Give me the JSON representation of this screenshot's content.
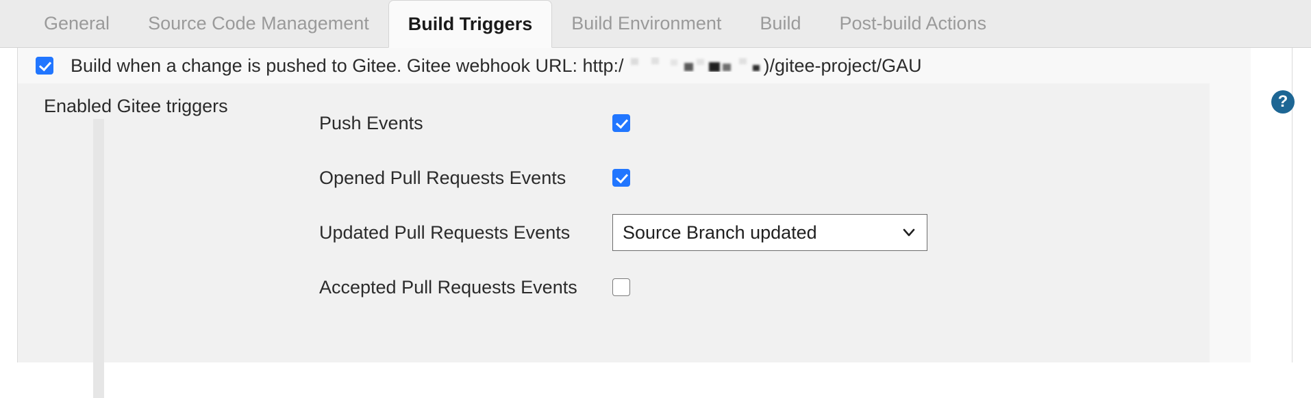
{
  "tabs": [
    {
      "label": "General",
      "active": false
    },
    {
      "label": "Source Code Management",
      "active": false
    },
    {
      "label": "Build Triggers",
      "active": true
    },
    {
      "label": "Build Environment",
      "active": false
    },
    {
      "label": "Build",
      "active": false
    },
    {
      "label": "Post-build Actions",
      "active": false
    }
  ],
  "build_trigger": {
    "checkbox_checked": true,
    "label_prefix": "Build when a change is pushed to Gitee. Gitee webhook URL: http:/",
    "label_suffix": ")/gitee-project/GAU",
    "redacted_note": "redacted-host-segment"
  },
  "triggers_section": {
    "label": "Enabled Gitee triggers",
    "rows": [
      {
        "label": "Push Events",
        "control": "checkbox",
        "checked": true
      },
      {
        "label": "Opened Pull Requests Events",
        "control": "checkbox",
        "checked": true
      },
      {
        "label": "Updated Pull Requests Events",
        "control": "select",
        "value": "Source Branch updated"
      },
      {
        "label": "Accepted Pull Requests Events",
        "control": "checkbox",
        "checked": false
      }
    ]
  },
  "help": {
    "glyph": "?",
    "name": "help-icon"
  },
  "colors": {
    "accent_checkbox": "#2176ff",
    "help_badge": "#1d6694",
    "tabbar_bg": "#ebebeb",
    "panel_bg": "#f1f1f1",
    "row_bg": "#f8f8f8"
  }
}
